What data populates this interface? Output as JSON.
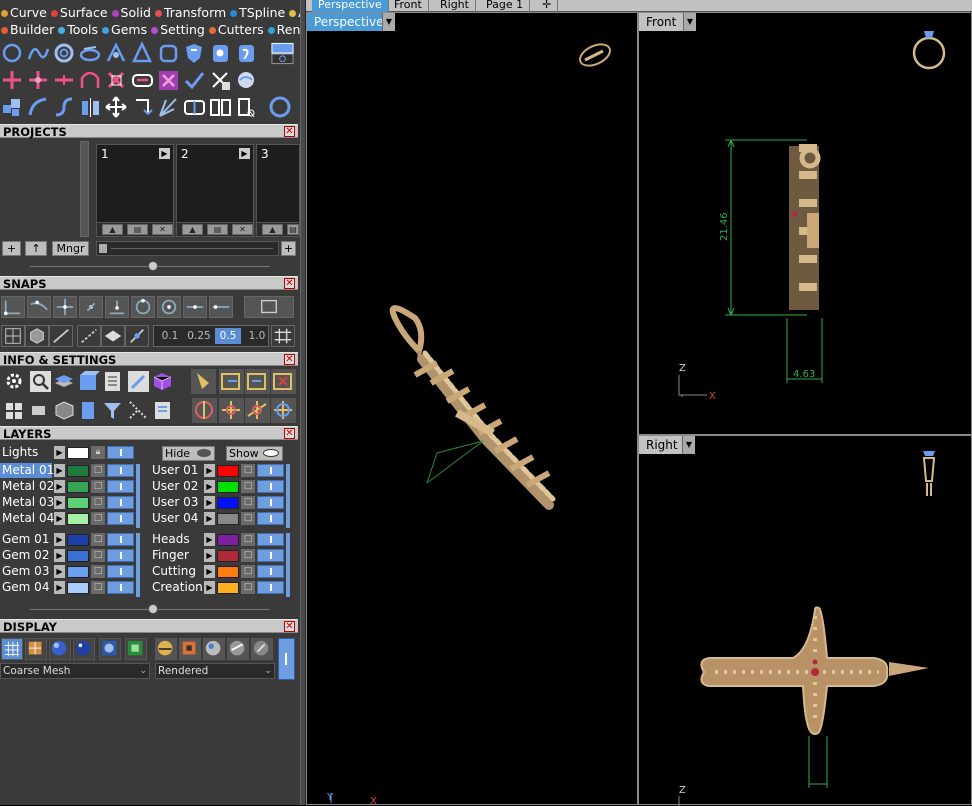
{
  "menu_row1": [
    {
      "label": "Curve",
      "color": "#e0a030"
    },
    {
      "label": "Surface",
      "color": "#e04040"
    },
    {
      "label": "Solid",
      "color": "#b040c0"
    },
    {
      "label": "Transform",
      "color": "#e05050"
    },
    {
      "label": "TSpline",
      "color": "#2a8ad8"
    },
    {
      "label": "Art",
      "color": "#e0c040"
    }
  ],
  "menu_row2": [
    {
      "label": "Builder",
      "color": "#e06030"
    },
    {
      "label": "Tools",
      "color": "#4ab0e0"
    },
    {
      "label": "Gems",
      "color": "#40a0e0"
    },
    {
      "label": "Setting",
      "color": "#b050d0"
    },
    {
      "label": "Cutters",
      "color": "#e07030"
    },
    {
      "label": "Render",
      "color": "#30a0d0"
    }
  ],
  "projects": {
    "title": "PROJECTS",
    "slots": [
      "1",
      "2",
      "3"
    ],
    "mngr_label": "Mngr"
  },
  "snaps": {
    "title": "SNAPS",
    "values": [
      "0.1",
      "0.25",
      "0.5",
      "1.0"
    ],
    "selected": "0.5"
  },
  "info_settings": {
    "title": "INFO & SETTINGS"
  },
  "layers": {
    "title": "LAYERS",
    "lights_label": "Lights",
    "hide_label": "Hide",
    "show_label": "Show",
    "left_group1": [
      {
        "name": "Metal 01",
        "color": "#1f7a3e",
        "selected": true
      },
      {
        "name": "Metal 02",
        "color": "#36a356"
      },
      {
        "name": "Metal 03",
        "color": "#5fd178"
      },
      {
        "name": "Metal 04",
        "color": "#a6f0a8"
      }
    ],
    "left_group2": [
      {
        "name": "Gem 01",
        "color": "#1e3fa8"
      },
      {
        "name": "Gem 02",
        "color": "#3b6fd6"
      },
      {
        "name": "Gem 03",
        "color": "#6aa0f0"
      },
      {
        "name": "Gem 04",
        "color": "#a9cdf8"
      }
    ],
    "right_group1": [
      {
        "name": "User 01",
        "color": "#ff0000"
      },
      {
        "name": "User 02",
        "color": "#00e000"
      },
      {
        "name": "User 03",
        "color": "#0010ff"
      },
      {
        "name": "User 04",
        "color": "#888888"
      }
    ],
    "right_group2": [
      {
        "name": "Heads",
        "color": "#7a1fa0"
      },
      {
        "name": "Finger",
        "color": "#b02a3a"
      },
      {
        "name": "Cutting",
        "color": "#ff7a10"
      },
      {
        "name": "Creation",
        "color": "#ffb020"
      }
    ]
  },
  "display": {
    "title": "DISPLAY",
    "mesh_select": "Coarse Mesh",
    "render_select": "Rendered"
  },
  "tabs": [
    "Perspective",
    "Front",
    "Right",
    "Page 1"
  ],
  "viewports": {
    "perspective": {
      "label": "Perspective"
    },
    "front": {
      "label": "Front",
      "dim_height": "21.46",
      "dim_width": "4.63",
      "axis_z": "Z",
      "axis_y": "Y",
      "axis_x": "X"
    },
    "right": {
      "label": "Right",
      "axis_z": "Z"
    },
    "perspective_axes": {
      "y": "Y",
      "x": "X"
    }
  },
  "colors": {
    "accent": "#4a9ad6",
    "gold": "#d6b98a",
    "panel": "#3a3a3a",
    "dimension_green": "#2fae4a"
  }
}
